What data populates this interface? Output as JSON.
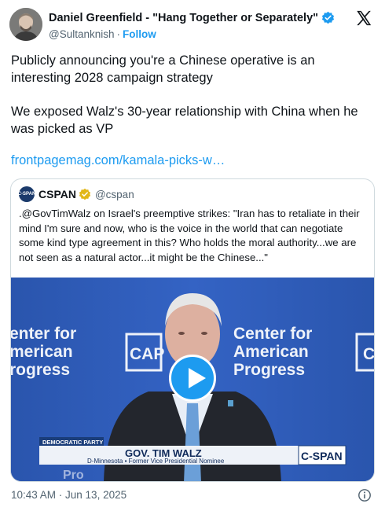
{
  "author": {
    "display_name": "Daniel Greenfield - \"Hang Together or Separately\"",
    "handle": "@Sultanknish",
    "follow_label": "Follow"
  },
  "tweet": {
    "paragraph1": "Publicly announcing you're a Chinese operative is an interesting 2028 campaign strategy",
    "paragraph2": "We exposed Walz's 30-year relationship with China when he was picked as VP",
    "link": "frontpagemag.com/kamala-picks-w…"
  },
  "quote": {
    "name": "CSPAN",
    "handle": "@cspan",
    "avatar_text": "C-SPAN",
    "text": ".@GovTimWalz on Israel's preemptive strikes: \"Iran has to retaliate in their mind I'm sure and now, who is the voice in the world that can negotiate some kind type agreement in this? Who holds the moral authority...we are not seen as a natural actor...it might be the Chinese...\""
  },
  "video": {
    "backdrop_text_left": [
      "enter for",
      "merican",
      "rogress"
    ],
    "backdrop_text_cap": "CAP",
    "backdrop_text_right": [
      "Center for",
      "American",
      "Progress"
    ],
    "backdrop_text_edge": "C",
    "backdrop_bottom_left": "Pro",
    "chyron_tag": "DEMOCRATIC PARTY",
    "chyron_name": "GOV. TIM WALZ",
    "chyron_subtitle": "D-Minnesota  ▪  Former Vice Presidential Nominee",
    "network": "C-SPAN"
  },
  "footer": {
    "timestamp": "10:43 AM · Jun 13, 2025"
  },
  "colors": {
    "accent": "#1d9bf0",
    "verified_gold": "#e2b719",
    "video_blue": "#2b59b6"
  },
  "icons": {
    "verified": "verified-badge-icon",
    "logo": "x-logo-icon",
    "play": "play-icon",
    "info": "info-icon"
  }
}
